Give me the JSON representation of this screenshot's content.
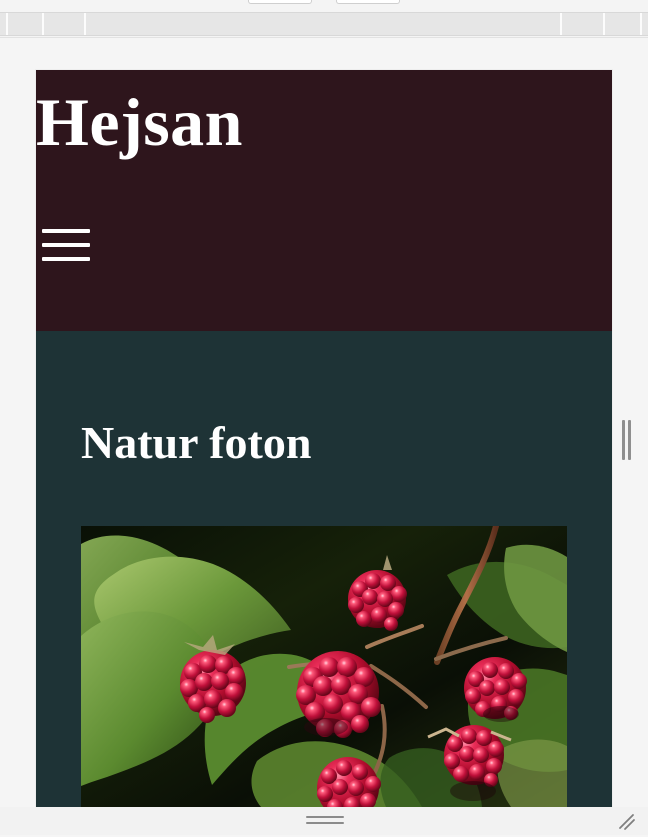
{
  "page": {
    "header": {
      "title": "Hejsan"
    },
    "content": {
      "section_title": "Natur foton"
    }
  },
  "icons": {
    "menu": "hamburger-menu-icon",
    "side_resize": "vertical-grip-icon",
    "bottom_resize": "horizontal-grip-icon",
    "corner_resize": "corner-resize-icon"
  },
  "colors": {
    "header_bg": "#2e151c",
    "content_bg": "#1e3336",
    "text": "#ffffff"
  }
}
